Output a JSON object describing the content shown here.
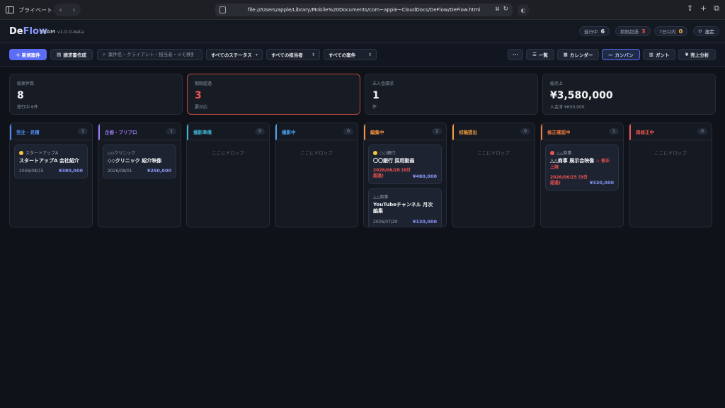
{
  "browser": {
    "sidebar_label": "プライベート",
    "url": "file:///Users/apple/Library/Mobile%20Documents/com~apple~CloudDocs/DeFlow/DeFlow.html"
  },
  "header": {
    "logo_de": "De",
    "logo_flow": "Flow",
    "team": "TEAM",
    "version": "v1.0.0-beta",
    "pills": [
      {
        "label": "進行中",
        "count": "6",
        "color": "#e5e7eb"
      },
      {
        "label": "期限超過",
        "count": "3",
        "color": "#ef5350"
      },
      {
        "label": "7日以内",
        "count": "0",
        "color": "#f5b942"
      }
    ],
    "settings_label": "設定"
  },
  "toolbar": {
    "new_project": "＋ 新規案件",
    "invoice": "請求書作成",
    "search_placeholder": "案件名・クライアント・担当者・メモ検索",
    "status_filter": "すべてのステータス",
    "assignee_filter": "すべての担当者",
    "project_filter": "すべての案件",
    "more": "···",
    "views": {
      "list": "一覧",
      "calendar": "カレンダー",
      "kanban": "カンバン",
      "gantt": "ガント",
      "sales": "売上分析"
    }
  },
  "stats": [
    {
      "label": "総案件数",
      "value": "8",
      "sub": "進行中 6件"
    },
    {
      "label": "期限超過",
      "value": "3",
      "sub": "要対応"
    },
    {
      "label": "未入金請求",
      "value": "1",
      "sub": "件"
    },
    {
      "label": "総売上",
      "value": "¥3,580,000",
      "sub": "入金済 ¥650,000"
    }
  ],
  "colors": {
    "accent": "#5b6cf5",
    "danger": "#ef5350",
    "col_blue": "#4f8df5",
    "col_purple": "#9b7bf5",
    "col_cyan": "#3fb6d8",
    "col_sky": "#4aa3ef",
    "col_orange": "#f5913e",
    "col_amber": "#f09a3e",
    "col_deep_orange": "#f07a3e",
    "col_red": "#ef5350"
  },
  "dropzone_text": "ここにドロップ",
  "columns": [
    {
      "title": "受注・見積",
      "count": "1",
      "cards": [
        {
          "client": "スタートアップA",
          "title": "スタートアップA 会社紹介",
          "date": "2026/08/15",
          "price": "¥380,000"
        }
      ]
    },
    {
      "title": "企画・プリプロ",
      "count": "1",
      "cards": [
        {
          "client": "◇◇クリニック",
          "title": "◇◇クリニック 紹介映像",
          "date": "2026/08/01",
          "price": "¥250,000"
        }
      ]
    },
    {
      "title": "撮影準備",
      "count": "0",
      "cards": []
    },
    {
      "title": "撮影中",
      "count": "0",
      "cards": []
    },
    {
      "title": "編集中",
      "count": "2",
      "cards": [
        {
          "client": "○○銀行",
          "title": "〇〇銀行 採用動画",
          "date": "2026/06/28 (6日超過)",
          "price": "¥480,000"
        },
        {
          "client": "△△商事",
          "title": "YouTubeチャンネル 月次編集",
          "date": "2026/07/20",
          "price": "¥120,000"
        }
      ]
    },
    {
      "title": "初稿提出",
      "count": "0",
      "cards": []
    },
    {
      "title": "修正確認中",
      "count": "1",
      "cards": [
        {
          "client": "△△商事",
          "title": "△△商事 展示会映像",
          "warn": "⚠ 修正上限",
          "date": "2026/06/25 (9日超過)",
          "price": "¥320,000"
        }
      ]
    },
    {
      "title": "再修正中",
      "count": "0",
      "cards": []
    }
  ]
}
